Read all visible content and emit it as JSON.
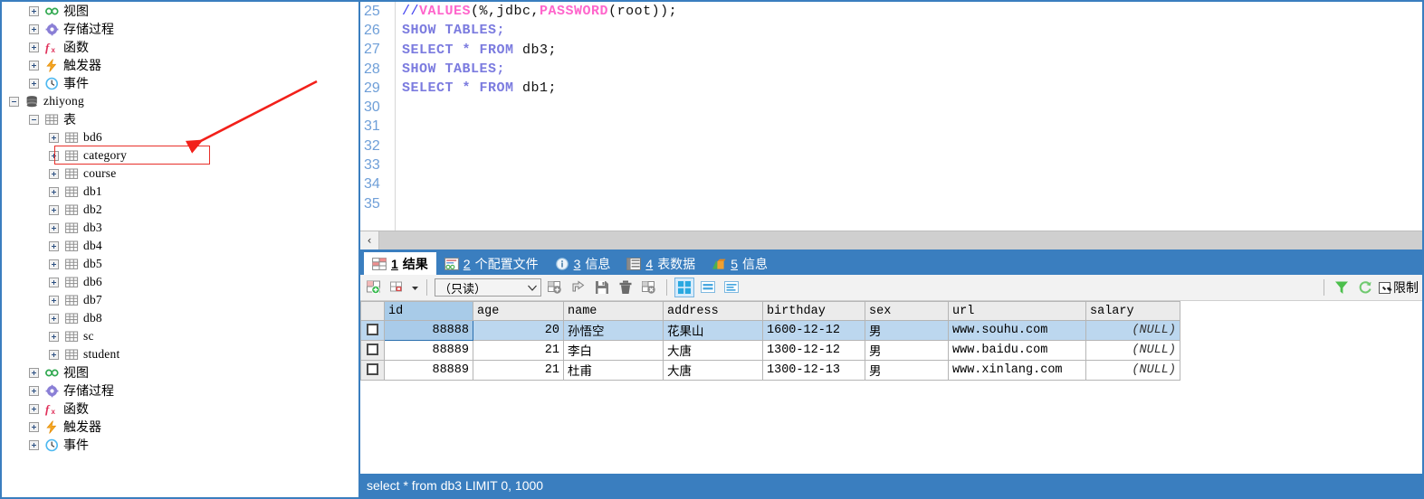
{
  "tree": {
    "items": [
      {
        "indent": 1,
        "expander": "plus",
        "icon": "view-icon",
        "label": "视图",
        "mono": false
      },
      {
        "indent": 1,
        "expander": "plus",
        "icon": "procedure-icon",
        "label": "存储过程",
        "mono": false
      },
      {
        "indent": 1,
        "expander": "plus",
        "icon": "function-icon",
        "label": "函数",
        "mono": false
      },
      {
        "indent": 1,
        "expander": "plus",
        "icon": "trigger-icon",
        "label": "触发器",
        "mono": false
      },
      {
        "indent": 1,
        "expander": "plus",
        "icon": "event-icon",
        "label": "事件",
        "mono": false
      },
      {
        "indent": 0,
        "expander": "minus",
        "icon": "database-icon",
        "label": "zhiyong",
        "mono": true
      },
      {
        "indent": 1,
        "expander": "minus",
        "icon": "table-icon",
        "label": "表",
        "mono": false
      },
      {
        "indent": 2,
        "expander": "plus",
        "icon": "table-icon",
        "label": "bd6",
        "mono": true
      },
      {
        "indent": 2,
        "expander": "plus",
        "icon": "table-icon",
        "label": "category",
        "mono": true
      },
      {
        "indent": 2,
        "expander": "plus",
        "icon": "table-icon",
        "label": "course",
        "mono": true
      },
      {
        "indent": 2,
        "expander": "plus",
        "icon": "table-icon",
        "label": "db1",
        "mono": true
      },
      {
        "indent": 2,
        "expander": "plus",
        "icon": "table-icon",
        "label": "db2",
        "mono": true
      },
      {
        "indent": 2,
        "expander": "plus",
        "icon": "table-icon",
        "label": "db3",
        "mono": true
      },
      {
        "indent": 2,
        "expander": "plus",
        "icon": "table-icon",
        "label": "db4",
        "mono": true
      },
      {
        "indent": 2,
        "expander": "plus",
        "icon": "table-icon",
        "label": "db5",
        "mono": true
      },
      {
        "indent": 2,
        "expander": "plus",
        "icon": "table-icon",
        "label": "db6",
        "mono": true
      },
      {
        "indent": 2,
        "expander": "plus",
        "icon": "table-icon",
        "label": "db7",
        "mono": true
      },
      {
        "indent": 2,
        "expander": "plus",
        "icon": "table-icon",
        "label": "db8",
        "mono": true
      },
      {
        "indent": 2,
        "expander": "plus",
        "icon": "table-icon",
        "label": "sc",
        "mono": true
      },
      {
        "indent": 2,
        "expander": "plus",
        "icon": "table-icon",
        "label": "student",
        "mono": true
      },
      {
        "indent": 1,
        "expander": "plus",
        "icon": "view-icon",
        "label": "视图",
        "mono": false
      },
      {
        "indent": 1,
        "expander": "plus",
        "icon": "procedure-icon",
        "label": "存储过程",
        "mono": false
      },
      {
        "indent": 1,
        "expander": "plus",
        "icon": "function-icon",
        "label": "函数",
        "mono": false
      },
      {
        "indent": 1,
        "expander": "plus",
        "icon": "trigger-icon",
        "label": "触发器",
        "mono": false
      },
      {
        "indent": 1,
        "expander": "plus",
        "icon": "event-icon",
        "label": "事件",
        "mono": false
      }
    ],
    "annotation": {
      "highlight_label": "category",
      "highlight_color": "#e8302a"
    }
  },
  "editor": {
    "lines": [
      {
        "num": "25",
        "tokens": [
          {
            "t": "//",
            "c": "cmt"
          },
          {
            "t": "VALUES",
            "c": "magenta"
          },
          {
            "t": "(%,jdbc,",
            "c": "plain"
          },
          {
            "t": "PASSWORD",
            "c": "magenta"
          },
          {
            "t": "(root));",
            "c": "plain"
          }
        ]
      },
      {
        "num": "26",
        "tokens": [
          {
            "t": "SHOW TABLES;",
            "c": "kw"
          }
        ]
      },
      {
        "num": "27",
        "tokens": [
          {
            "t": "SELECT * FROM ",
            "c": "kw"
          },
          {
            "t": "db3;",
            "c": "plain"
          }
        ]
      },
      {
        "num": "28",
        "tokens": [
          {
            "t": "SHOW TABLES;",
            "c": "kw"
          }
        ]
      },
      {
        "num": "29",
        "tokens": [
          {
            "t": "SELECT * FROM ",
            "c": "kw"
          },
          {
            "t": "db1;",
            "c": "plain"
          }
        ]
      },
      {
        "num": "30",
        "tokens": []
      },
      {
        "num": "31",
        "tokens": []
      },
      {
        "num": "32",
        "tokens": []
      },
      {
        "num": "33",
        "tokens": []
      },
      {
        "num": "34",
        "tokens": []
      },
      {
        "num": "35",
        "tokens": []
      }
    ],
    "scroll_left_label": "‹"
  },
  "result_tabs": [
    {
      "num": "1",
      "label": "结果",
      "icon": "result-grid-icon",
      "active": true
    },
    {
      "num": "2",
      "label": "个配置文件",
      "icon": "profile-icon",
      "active": false
    },
    {
      "num": "3",
      "label": "信息",
      "icon": "info-icon",
      "active": false
    },
    {
      "num": "4",
      "label": "表数据",
      "icon": "table-data-icon",
      "active": false
    },
    {
      "num": "5",
      "label": "信息",
      "icon": "chart-info-icon",
      "active": false
    }
  ],
  "result_toolbar": {
    "mode_value": "（只读）",
    "limit_label": "限制",
    "buttons": [
      {
        "name": "add-row-button",
        "icon": "grid-add-icon"
      },
      {
        "name": "edit-mode-button",
        "icon": "grid-edit-dropdown-icon"
      },
      {
        "name": "export-button",
        "icon": "grid-export-icon"
      },
      {
        "name": "fetch-button",
        "icon": "grid-fetch-icon"
      },
      {
        "name": "save-button",
        "icon": "floppy-save-icon"
      },
      {
        "name": "delete-button",
        "icon": "trash-icon"
      },
      {
        "name": "clear-button",
        "icon": "grid-clear-icon"
      },
      {
        "name": "grid-view-button",
        "icon": "grid-view-icon"
      },
      {
        "name": "form-view-button",
        "icon": "form-view-icon"
      },
      {
        "name": "field-view-button",
        "icon": "field-view-icon"
      }
    ],
    "right_buttons": [
      {
        "name": "filter-button",
        "icon": "funnel-filter-icon"
      },
      {
        "name": "refresh-button",
        "icon": "refresh-icon"
      }
    ]
  },
  "grid": {
    "columns": [
      "id",
      "age",
      "name",
      "address",
      "birthday",
      "sex",
      "url",
      "salary"
    ],
    "selected_column": "id",
    "rows": [
      {
        "selected": true,
        "id": "88888",
        "age": "20",
        "name": "孙悟空",
        "address": "花果山",
        "birthday": "1600-12-12",
        "sex": "男",
        "url": "www.souhu.com",
        "salary": "(NULL)"
      },
      {
        "selected": false,
        "id": "88889",
        "age": "21",
        "name": "李白",
        "address": "大唐",
        "birthday": "1300-12-12",
        "sex": "男",
        "url": "www.baidu.com",
        "salary": "(NULL)"
      },
      {
        "selected": false,
        "id": "88889",
        "age": "21",
        "name": "杜甫",
        "address": "大唐",
        "birthday": "1300-12-13",
        "sex": "男",
        "url": "www.xinlang.com",
        "salary": "(NULL)"
      }
    ]
  },
  "statusbar": {
    "query": "select * from db3 LIMIT 0, 1000"
  },
  "colors": {
    "accent_blue": "#3a7ebf",
    "selection_blue": "#bcd7ef",
    "annotation_red": "#e8302a",
    "keyword_purple": "#7b7bdf",
    "magenta": "#ff66cc"
  }
}
